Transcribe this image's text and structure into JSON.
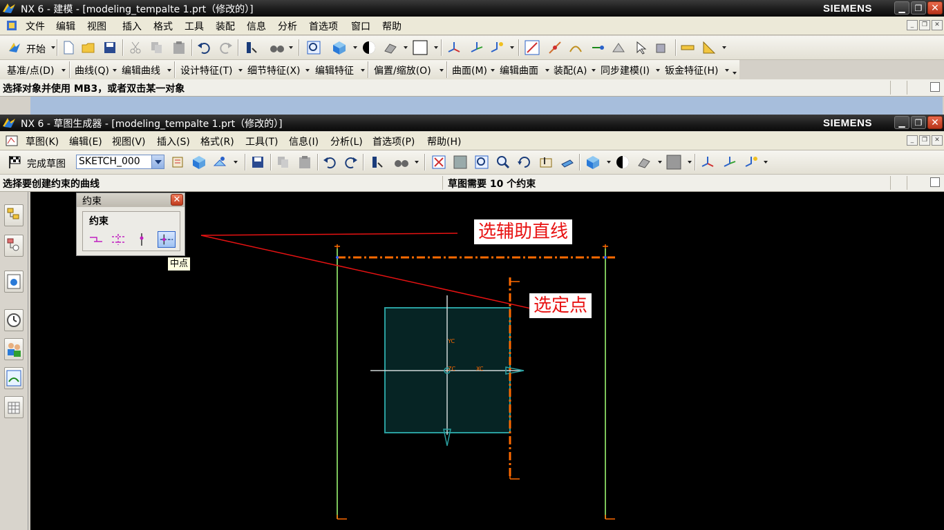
{
  "main_window": {
    "title": "NX 6 - 建模 - [modeling_tempalte 1.prt（修改的）]",
    "brand": "SIEMENS",
    "menu": [
      "文件",
      "编辑",
      "视图",
      "插入",
      "格式",
      "工具",
      "装配",
      "信息",
      "分析",
      "首选项",
      "窗口",
      "帮助"
    ],
    "toolbar": {
      "start_label": "开始"
    },
    "feature_toolbar": [
      "基准/点(D)",
      "曲线(Q)",
      "编辑曲线",
      "设计特征(T)",
      "细节特征(X)",
      "编辑特征",
      "偏置/缩放(O)",
      "曲面(M)",
      "编辑曲面",
      "装配(A)",
      "同步建模(I)",
      "钣金特征(H)"
    ],
    "status": "选择对象并使用 MB3，或者双击某一对象"
  },
  "sketch_window": {
    "title": "NX 6 - 草图生成器 - [modeling_tempalte 1.prt（修改的）]",
    "brand": "SIEMENS",
    "menu": [
      "草图(K)",
      "编辑(E)",
      "视图(V)",
      "插入(S)",
      "格式(R)",
      "工具(T)",
      "信息(I)",
      "分析(L)",
      "首选项(P)",
      "帮助(H)"
    ],
    "toolbar": {
      "finish_label": "完成草图",
      "sketch_name": "SKETCH_000"
    },
    "status_left": "选择要创建约束的曲线",
    "status_right": "草图需要 10 个约束"
  },
  "constraint_dialog": {
    "title": "约束",
    "group_label": "约束",
    "tooltip": "中点",
    "close_glyph": "✕"
  },
  "annotations": {
    "aux_line": "选辅助直线",
    "select_point": "选定点"
  },
  "viewport_labels": {
    "yc": "YC",
    "xc": "XC",
    "zc": "ZC"
  },
  "colors": {
    "sketch_green": "#7cc45a",
    "aux_orange": "#ff6a00",
    "datum_cyan": "#22b8b8",
    "annotation_red": "#e81212"
  }
}
